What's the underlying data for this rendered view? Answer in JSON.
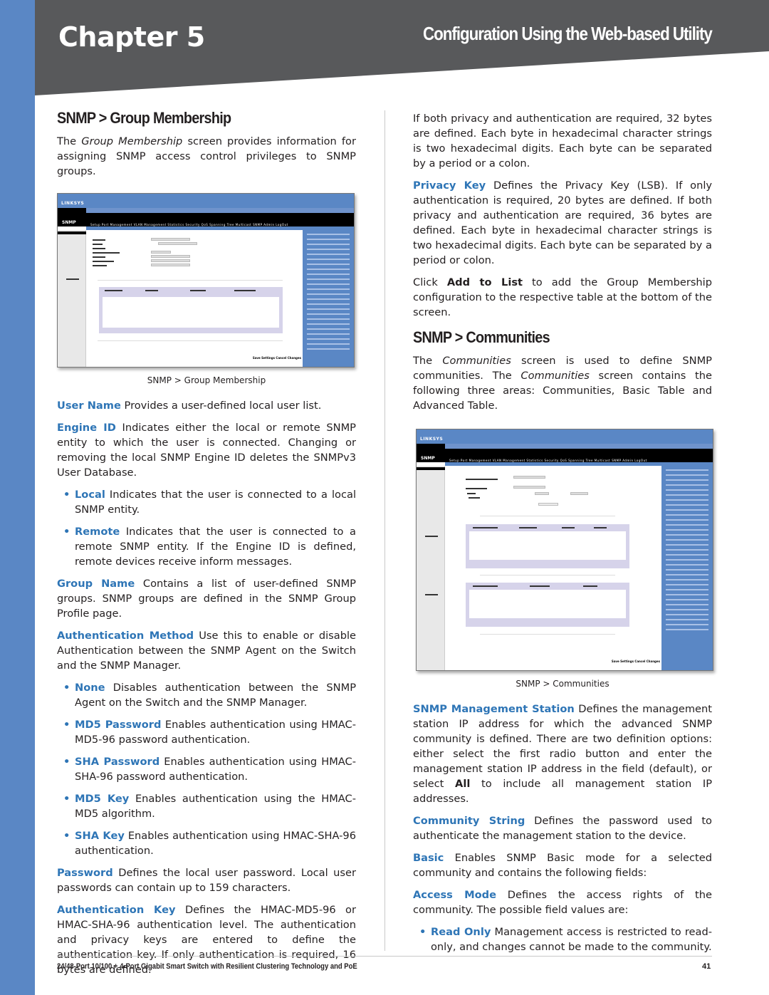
{
  "header": {
    "chapter": "Chapter 5",
    "title": "Configuration Using the Web-based Utility",
    "colors": {
      "band": "#58595b",
      "accent_bar": "#5a87c5",
      "term": "#2e75b6"
    }
  },
  "left_column": {
    "heading": "SNMP > Group Membership",
    "intro": {
      "pre": "The ",
      "em": "Group Membership",
      "post": " screen provides information for assigning SNMP access control privileges to SNMP groups."
    },
    "figure_caption": "SNMP >  Group Membership",
    "figure": {
      "logo": "LINKSYS",
      "section": "SNMP",
      "nav": "Setup  Port Management  VLAN Management  Statistics  Security  QoS  Spanning Tree  Multicast  SNMP  Admin  LogOut",
      "save_label": "Save Settings  Cancel Changes"
    },
    "definitions": [
      {
        "term": "User Name",
        "text": "  Provides a user-defined local user list."
      },
      {
        "term": "Engine ID",
        "text": "  Indicates either the local or remote SNMP entity to which the user is connected. Changing or removing the local SNMP Engine ID deletes the SNMPv3 User Database."
      }
    ],
    "engine_bullets": [
      {
        "term": "Local",
        "text": "  Indicates that the user is connected to a local SNMP entity."
      },
      {
        "term": "Remote",
        "text": "  Indicates that the user is connected to a remote SNMP entity. If the Engine ID is defined, remote devices receive inform messages."
      }
    ],
    "group_name": {
      "term": "Group Name",
      "text": " Contains a list of user-defined SNMP groups. SNMP groups are defined in the SNMP Group Profile page."
    },
    "auth_method": {
      "term": "Authentication Method",
      "text": " Use this to enable or disable Authentication between the SNMP Agent on the Switch and the SNMP Manager."
    },
    "auth_bullets": [
      {
        "term": "None",
        "text": " Disables authentication between the SNMP Agent on the Switch and the SNMP Manager."
      },
      {
        "term": "MD5 Password",
        "text": "  Enables authentication using HMAC-MD5-96 password authentication."
      },
      {
        "term": "SHA Password",
        "text": "  Enables authentication using HMAC-SHA-96 password authentication."
      },
      {
        "term": "MD5 Key",
        "text": "   Enables authentication using the HMAC-MD5 algorithm."
      },
      {
        "term": "SHA Key",
        "text": "  Enables authentication using HMAC-SHA-96 authentication."
      }
    ],
    "password": {
      "term": "Password",
      "text": " Defines the local user password. Local user passwords can contain up to 159 characters."
    },
    "auth_key": {
      "term": "Authentication Key",
      "text": " Defines the HMAC-MD5-96 or HMAC-SHA-96 authentication level. The authentication and privacy keys are entered to define the authentication key. If only authentication is required, 16 bytes are defined."
    }
  },
  "right_column": {
    "continuation": "If both privacy and authentication are required, 32 bytes are defined. Each byte in hexadecimal character strings is two hexadecimal digits. Each byte can be separated by a period or a colon.",
    "privacy_key": {
      "term": "Privacy Key",
      "text": " Defines the Privacy Key (LSB). If only authentication is required, 20 bytes are defined. If both privacy and authentication are required, 36 bytes are defined. Each byte in hexadecimal character strings is two hexadecimal digits. Each byte can be separated by a period or colon."
    },
    "add_to_list": {
      "pre": "Click ",
      "bold": "Add to List",
      "post": " to add the Group Membership configuration to the respective table at the bottom of the screen."
    },
    "heading": "SNMP > Communities",
    "intro": {
      "pre": "The ",
      "em1": "Communities",
      "mid": " screen is used to define SNMP communities. The ",
      "em2": "Communities",
      "post": " screen contains the following three areas: Communities, Basic Table and Advanced Table."
    },
    "figure_caption": "SNMP >  Communities",
    "figure": {
      "logo": "LINKSYS",
      "section": "SNMP",
      "nav": "Setup  Port Management  VLAN Management  Statistics  Security  QoS  Spanning Tree  Multicast  SNMP  Admin  LogOut",
      "save_label": "Save Settings  Cancel Changes"
    },
    "mgmt_station": {
      "term": "SNMP Management Station",
      "pre": "  Defines the management station IP address for which the advanced SNMP community is defined. There are two definition options: either select the first radio button and enter the management station IP address in the field (default), or select ",
      "bold": "All",
      "post": " to include all management station IP addresses."
    },
    "community_string": {
      "term": "Community String",
      "text": " Defines the password used to authenticate the management station to the device."
    },
    "basic": {
      "term": "Basic",
      "text": "  Enables SNMP Basic mode for a selected community and contains the following fields:"
    },
    "access_mode": {
      "term": "Access Mode",
      "text": "  Defines the access rights of the community. The possible field values are:"
    },
    "access_bullets": [
      {
        "term": "Read Only",
        "text": "  Management access is restricted to read-only, and changes cannot be made to the community."
      }
    ]
  },
  "footer": {
    "product": "24/48-Port 10/100 + 4-Port Gigabit Smart Switch with Resilient Clustering Technology and PoE",
    "page": "41"
  }
}
